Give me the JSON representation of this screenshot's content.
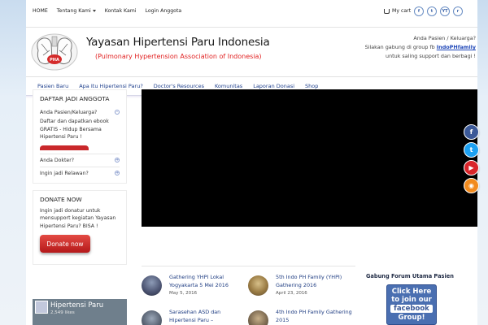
{
  "topbar": {
    "nav": [
      "HOME",
      "Tentang Kami",
      "Kontak Kami",
      "Login Anggota"
    ],
    "cart_label": "My cart",
    "social_icons": [
      "facebook-icon",
      "twitter-icon",
      "youtube-icon",
      "rss-icon"
    ],
    "social_glyphs": [
      "f",
      "t",
      "YT",
      "r"
    ]
  },
  "header": {
    "logo_text": "PHA",
    "title": "Yayasan Hipertensi Paru Indonesia",
    "subtitle": "(Pulmonary Hypertension Association of Indonesia)",
    "right_line1": "Anda Pasien / Keluarga?",
    "right_line2_prefix": "Silakan gabung di group fb ",
    "right_link": "IndoPHfamily",
    "right_line3": "untuk saling support dan berbagi !"
  },
  "mainnav": [
    "Pasien Baru",
    "Apa Itu Hipertensi Paru?",
    "Doctor's Resources",
    "Komunitas",
    "Laporan Donasi",
    "Shop"
  ],
  "sidebar": {
    "join_title": "DAFTAR JADI ANGGOTA",
    "q1": "Anda Pasien/Keluarga?",
    "q1_body": "Daftar dan dapatkan ebook GRATIS - Hidup Bersama Hipertensi Paru !",
    "q2": "Anda Dokter?",
    "q3": "Ingin jadi Relawan?",
    "donate_title": "DONATE NOW",
    "donate_text": "Ingin jadi donatur untuk mensupport kegiatan Yayasan Hipertensi Paru? BISA !",
    "donate_button": "Donate now",
    "fb_title": "Hipertensi Paru",
    "fb_count": "2,549 likes"
  },
  "posts": [
    {
      "title": "Gathering YHPI Lokal Yogyakarta 5 Mei 2016",
      "date": "May 5, 2016"
    },
    {
      "title": "5th Indo PH Family (YHPI) Gathering 2016",
      "date": "April 23, 2016"
    },
    {
      "title": "Sarasehan ASD dan Hipertensi Paru –",
      "date": ""
    },
    {
      "title": "4th Indo PH Family Gathering 2015",
      "date": ""
    }
  ],
  "forum": {
    "title": "Gabung Forum Utama Pasien",
    "lines": [
      "Click Here",
      "to join our",
      "facebook",
      "Group!"
    ]
  },
  "side_socials": [
    {
      "icon": "facebook-icon",
      "glyph": "f",
      "color": "#3b5998"
    },
    {
      "icon": "twitter-icon",
      "glyph": "t",
      "color": "#1da1f2"
    },
    {
      "icon": "youtube-icon",
      "glyph": "▶",
      "color": "#d9252a"
    },
    {
      "icon": "rss-icon",
      "glyph": "◉",
      "color": "#f28b1e"
    }
  ]
}
